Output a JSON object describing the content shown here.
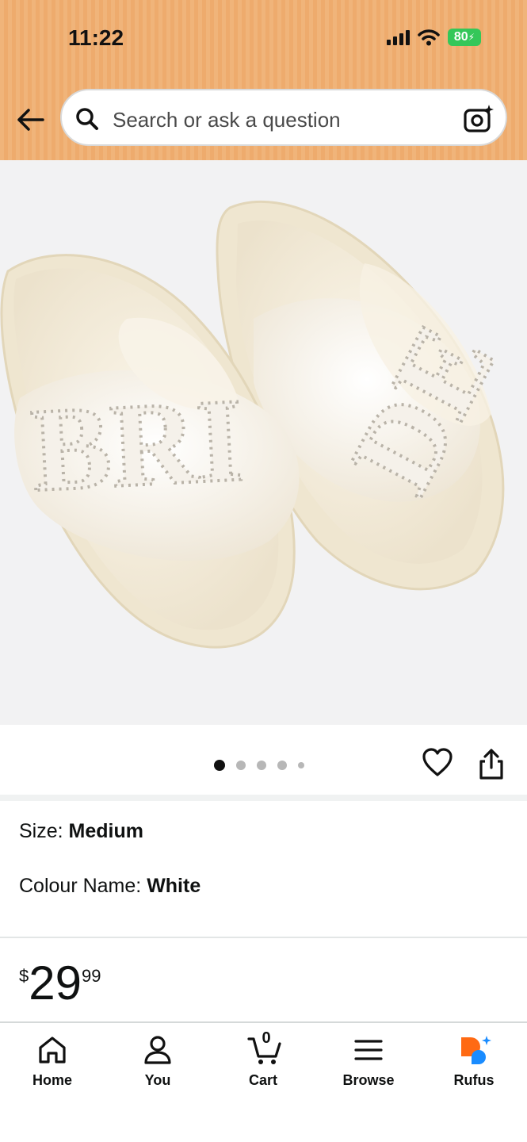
{
  "status_bar": {
    "time": "11:22",
    "battery": "80"
  },
  "search": {
    "placeholder": "Search or ask a question"
  },
  "product": {
    "image_letters_left": "BRI",
    "image_letters_right": "DE",
    "carousel": {
      "count": 5,
      "active_index": 0
    },
    "size_label": "Size:",
    "size_value": "Medium",
    "colour_label": "Colour Name:",
    "colour_value": "White",
    "price": {
      "currency": "$",
      "whole": "29",
      "fraction": "99"
    }
  },
  "nav": {
    "items": [
      {
        "label": "Home",
        "icon": "home-icon"
      },
      {
        "label": "You",
        "icon": "person-icon"
      },
      {
        "label": "Cart",
        "icon": "cart-icon",
        "count": "0"
      },
      {
        "label": "Browse",
        "icon": "menu-icon"
      },
      {
        "label": "Rufus",
        "icon": "rufus-icon"
      }
    ]
  },
  "colors": {
    "header": "#f0b47a",
    "battery": "#34c759",
    "rufus_orange": "#ff6a13",
    "rufus_blue": "#1a8cff"
  }
}
